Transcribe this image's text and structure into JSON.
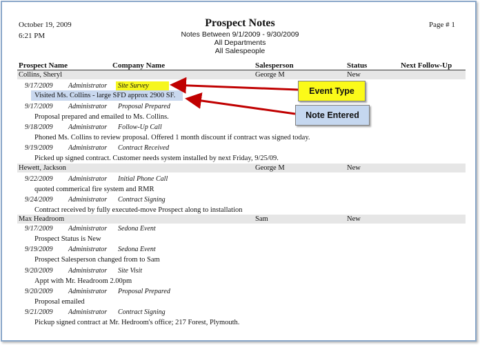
{
  "header": {
    "date": "October 19, 2009",
    "time": "6:21 PM",
    "title": "Prospect Notes",
    "subtitle_range": "Notes Between 9/1/2009 - 9/30/2009",
    "subtitle_depts": "All Departments",
    "subtitle_sales": "All Salespeople",
    "page": "Page # 1"
  },
  "columns": {
    "prospect": "Prospect Name",
    "company": "Company Name",
    "salesperson": "Salesperson",
    "status": "Status",
    "followup": "Next Follow-Up"
  },
  "prospects": [
    {
      "name": "Collins, Sheryl",
      "salesperson": "George M",
      "status": "New",
      "events": [
        {
          "date": "9/17/2009",
          "user": "Administrator",
          "type": "Site Survey",
          "note": "Visited Ms. Collins - large SFD approx 2900 SF."
        },
        {
          "date": "9/17/2009",
          "user": "Administrator",
          "type": "Proposal Prepared",
          "note": "Proposal prepared and emailed to Ms. Collins."
        },
        {
          "date": "9/18/2009",
          "user": "Administrator",
          "type": "Follow-Up Call",
          "note": "Phoned Ms. Collins to review proposal. Offered 1 month discount if contract was signed today."
        },
        {
          "date": "9/19/2009",
          "user": "Administrator",
          "type": "Contract Received",
          "note": "Picked up signed contract. Customer needs system installed by next Friday, 9/25/09."
        }
      ]
    },
    {
      "name": "Hewett, Jackson",
      "salesperson": "George M",
      "status": "New",
      "events": [
        {
          "date": "9/22/2009",
          "user": "Administrator",
          "type": "Initial Phone Call",
          "note": "quoted commerical fire system and RMR"
        },
        {
          "date": "9/24/2009",
          "user": "Administrator",
          "type": "Contract Signing",
          "note": "Contract received by fully executed-move Prospect along to installation"
        }
      ]
    },
    {
      "name": "Max Headroom",
      "salesperson": "Sam",
      "status": "New",
      "events": [
        {
          "date": "9/17/2009",
          "user": "Administrator",
          "type": "Sedona Event",
          "note": "Prospect Status is New"
        },
        {
          "date": "9/19/2009",
          "user": "Administrator",
          "type": "Sedona Event",
          "note": "Prospect Salesperson changed from  to Sam"
        },
        {
          "date": "9/20/2009",
          "user": "Administrator",
          "type": "Site Visit",
          "note": "Appt with Mr. Headroom 2.00pm"
        },
        {
          "date": "9/20/2009",
          "user": "Administrator",
          "type": "Proposal Prepared",
          "note": "Proposal emailed"
        },
        {
          "date": "9/21/2009",
          "user": "Administrator",
          "type": "Contract Signing",
          "note": "Pickup  signed contract at Mr. Hedroom's office; 217 Forest, Plymouth."
        }
      ]
    }
  ],
  "callouts": {
    "event_type": "Event Type",
    "note_entered": "Note Entered"
  },
  "colors": {
    "event_type_highlight": "#f6f61e",
    "note_highlight": "#c9d8ef",
    "arrow": "#c00000",
    "prospect_row_bg": "#e6e6e6"
  }
}
